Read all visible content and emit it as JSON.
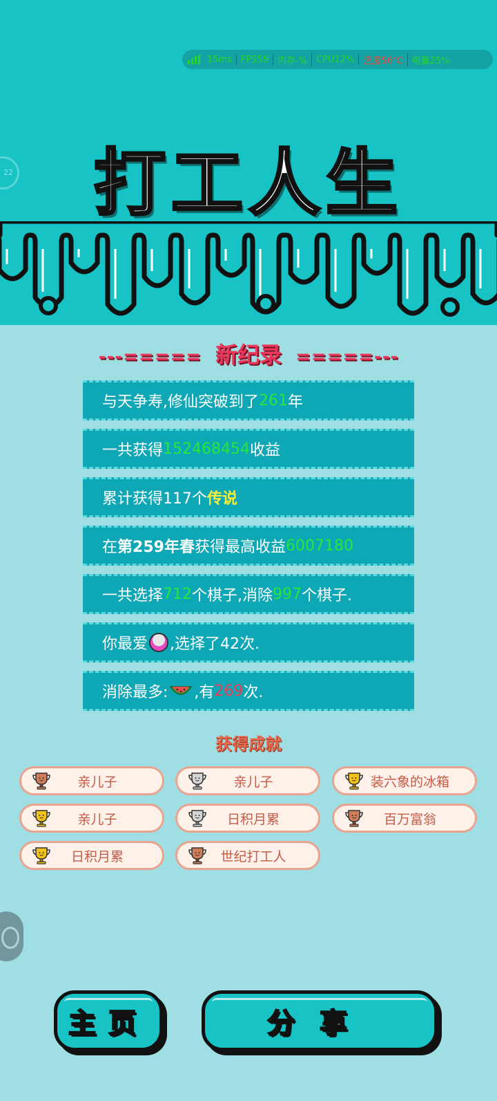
{
  "status": {
    "ping": "15ms",
    "fps": "FPS59",
    "memory": "内存-%",
    "cpu": "CPU12%",
    "temp": "温度56℃",
    "battery": "电量25%"
  },
  "colors": {
    "bg_top": "#17c3c4",
    "bg_main": "#9fdfe3",
    "row_bg": "#0ea7b5",
    "green": "#26e83a",
    "yellow": "#f6ee3a",
    "red": "#e9385c"
  },
  "side_ring_text": "22",
  "title": "打工人生",
  "record": {
    "dash_left": "---=====",
    "label": "新纪录",
    "dash_right": "=====---"
  },
  "stats": {
    "r1": {
      "pre": "与天争寿,修仙突破到了",
      "num": "261",
      "post": "年"
    },
    "r2": {
      "pre": "一共获得",
      "num": "152468454",
      "post": "收益"
    },
    "r3": {
      "pre": "累计获得117个",
      "hl": "传说"
    },
    "r4": {
      "pre": "在 ",
      "bold": "第259年春",
      "mid": " 获得最高收益",
      "num": "6007180"
    },
    "r5": {
      "a": "一共选择",
      "n1": "712",
      "b": "个棋子,消除",
      "n2": "997",
      "c": "个棋子."
    },
    "r6": {
      "pre": "你最爱",
      "icon": "egg-ball-icon",
      "post": ",选择了42次."
    },
    "r7": {
      "pre": "消除最多:",
      "icon": "watermelon-icon",
      "mid": ",有",
      "num": "269",
      "post": "次."
    }
  },
  "achievements_title": "获得成就",
  "achievements": [
    {
      "label": "亲儿子",
      "cup": "bronze"
    },
    {
      "label": "亲儿子",
      "cup": "silver"
    },
    {
      "label": "装六象的冰箱",
      "cup": "gold"
    },
    {
      "label": "亲儿子",
      "cup": "gold"
    },
    {
      "label": "日积月累",
      "cup": "silver"
    },
    {
      "label": "百万富翁",
      "cup": "bronze"
    },
    {
      "label": "日积月累",
      "cup": "gold"
    },
    {
      "label": "世纪打工人",
      "cup": "bronze"
    }
  ],
  "buttons": {
    "home": "主页",
    "share": "分享"
  }
}
